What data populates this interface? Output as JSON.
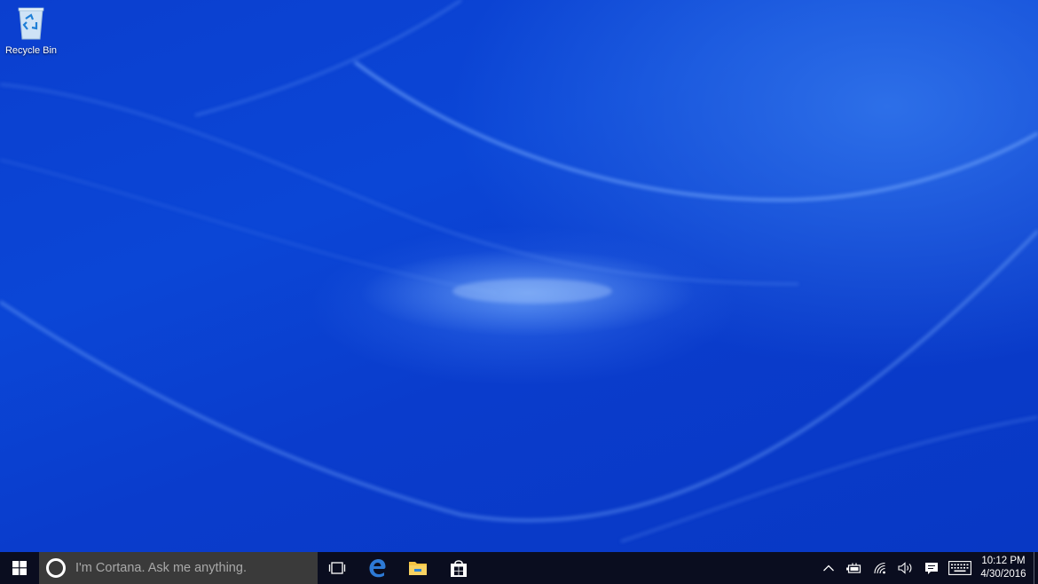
{
  "desktop": {
    "icons": [
      {
        "label": "Recycle Bin",
        "icon": "recycle-bin-icon"
      }
    ]
  },
  "taskbar": {
    "start_icon": "windows-logo-icon",
    "search": {
      "icon": "cortana-icon",
      "placeholder": "I'm Cortana. Ask me anything."
    },
    "task_view_icon": "task-view-icon",
    "pinned_apps": [
      {
        "name": "Microsoft Edge",
        "icon": "edge-icon"
      },
      {
        "name": "File Explorer",
        "icon": "file-explorer-icon"
      },
      {
        "name": "Store",
        "icon": "store-icon"
      }
    ],
    "tray": {
      "icons": [
        "chevron-up-icon",
        "battery-icon",
        "wifi-icon",
        "volume-icon",
        "action-center-icon",
        "keyboard-icon"
      ],
      "time": "10:12 PM",
      "date": "4/30/2016"
    }
  },
  "colors": {
    "desktop_blue": "#0b43d2",
    "taskbar": "#0a0d1f",
    "search_box": "#3a3a3a",
    "edge_blue": "#2d7ad6",
    "folder_yellow": "#f5c443"
  }
}
